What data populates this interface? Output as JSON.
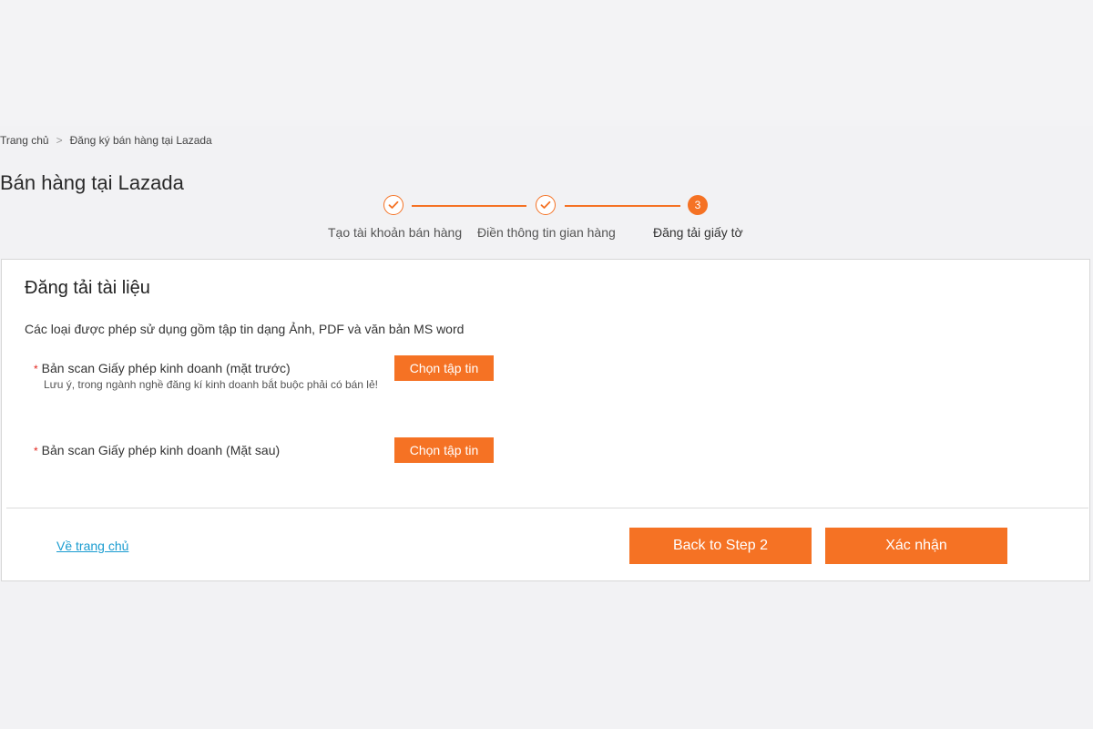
{
  "breadcrumb": {
    "home": "Trang chủ",
    "separator": ">",
    "current": "Đăng ký bán hàng tại Lazada"
  },
  "page_title": "Bán hàng tại Lazada",
  "stepper": {
    "steps": [
      {
        "label": "Tạo tài khoản bán hàng",
        "status": "done"
      },
      {
        "label": "Điền thông tin gian hàng",
        "status": "done"
      },
      {
        "label": "Đăng tải giấy tờ",
        "status": "active",
        "number": "3"
      }
    ],
    "accent_color": "#f57224"
  },
  "upload": {
    "title": "Đăng tải tài liệu",
    "description": "Các loại được phép sử dụng gồm tập tin dạng Ảnh, PDF và văn bản MS word",
    "required_marker": "*",
    "fields": [
      {
        "label": "Bản scan Giấy phép kinh doanh (mặt trước)",
        "note": "Lưu ý, trong ngành nghề đăng kí kinh doanh bắt buộc phải có bán lẻ!",
        "button": "Chọn tập tin"
      },
      {
        "label": "Bản scan Giấy phép kinh doanh (Mặt sau)",
        "button": "Chọn tập tin"
      }
    ]
  },
  "footer": {
    "home_link": "Về trang chủ",
    "back_button": "Back to Step 2",
    "confirm_button": "Xác nhận"
  }
}
